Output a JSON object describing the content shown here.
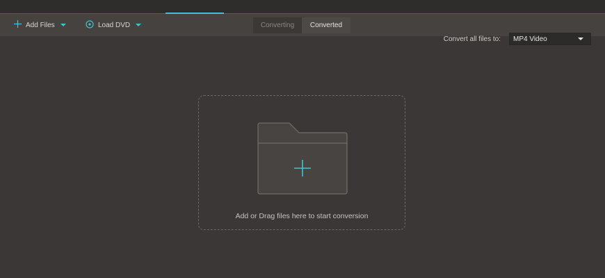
{
  "toolbar": {
    "add_files_label": "Add Files",
    "load_dvd_label": "Load DVD",
    "tabs": [
      "Converting",
      "Converted"
    ],
    "convert_all_label": "Convert all files to:",
    "format_value": "MP4 Video"
  },
  "dropzone": {
    "hint": "Add or Drag files here to start conversion"
  },
  "icons": {
    "add": "plus-icon",
    "dvd": "disc-icon",
    "dropdown": "caret-down-icon",
    "folder": "folder-add-icon"
  },
  "colors": {
    "accent": "#3fc3d3",
    "background": "#3a3736",
    "toolbar": "#46423f"
  }
}
